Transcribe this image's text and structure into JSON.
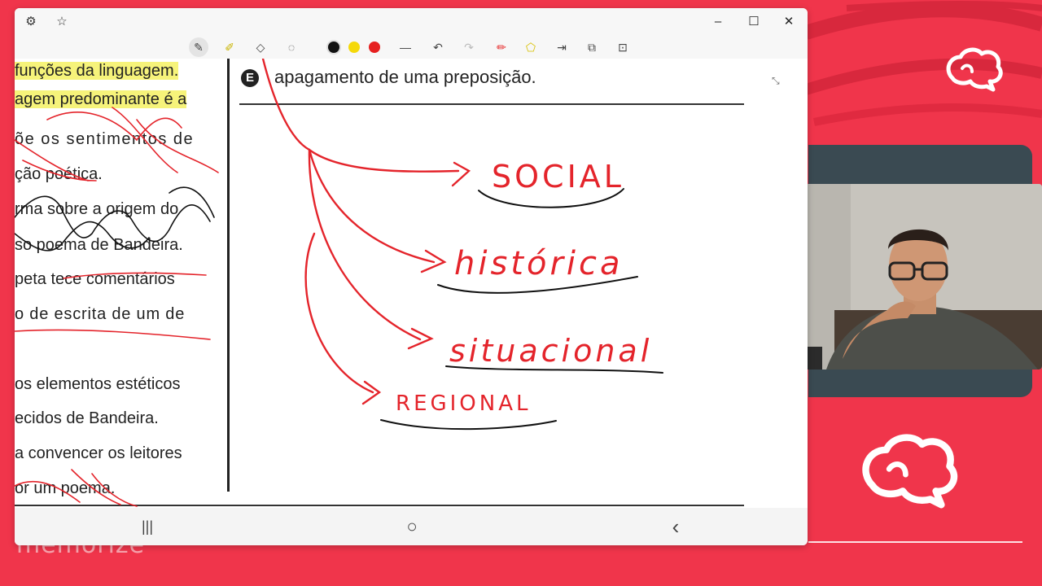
{
  "brand": {
    "watermark": "memorize"
  },
  "window": {
    "title_icons": [
      "gear-icon",
      "star-icon"
    ],
    "controls": {
      "minimize": "–",
      "maximize": "☐",
      "close": "✕"
    }
  },
  "toolbar": {
    "tools": [
      "pen-icon",
      "highlighter-icon",
      "eraser-icon",
      "lasso-icon"
    ],
    "colors": [
      "#111111",
      "#f5d90a",
      "#e62020"
    ],
    "actions": [
      "line-icon",
      "undo-icon",
      "redo-icon",
      "marker-icon",
      "shape-icon",
      "text-icon",
      "copy-icon",
      "lock-icon"
    ]
  },
  "page": {
    "left_lines": [
      "funções da linguagem.",
      "agem predominante é a",
      "õe os sentimentos de",
      "ção poética.",
      "rma sobre a origem do",
      "so poema de Bandeira.",
      "peta tece comentários",
      "o de escrita de um de",
      "",
      "os elementos estéticos",
      "ecidos de Bandeira.",
      "a convencer os leitores",
      "or um poema."
    ],
    "option_letter": "E",
    "option_text": "apagamento de uma preposição.",
    "handwritten": [
      "SOCIAL",
      "histórica",
      "situacional",
      "REGIONAL"
    ]
  },
  "navbar": {
    "recents": "|||",
    "home": "○",
    "back": "‹"
  }
}
